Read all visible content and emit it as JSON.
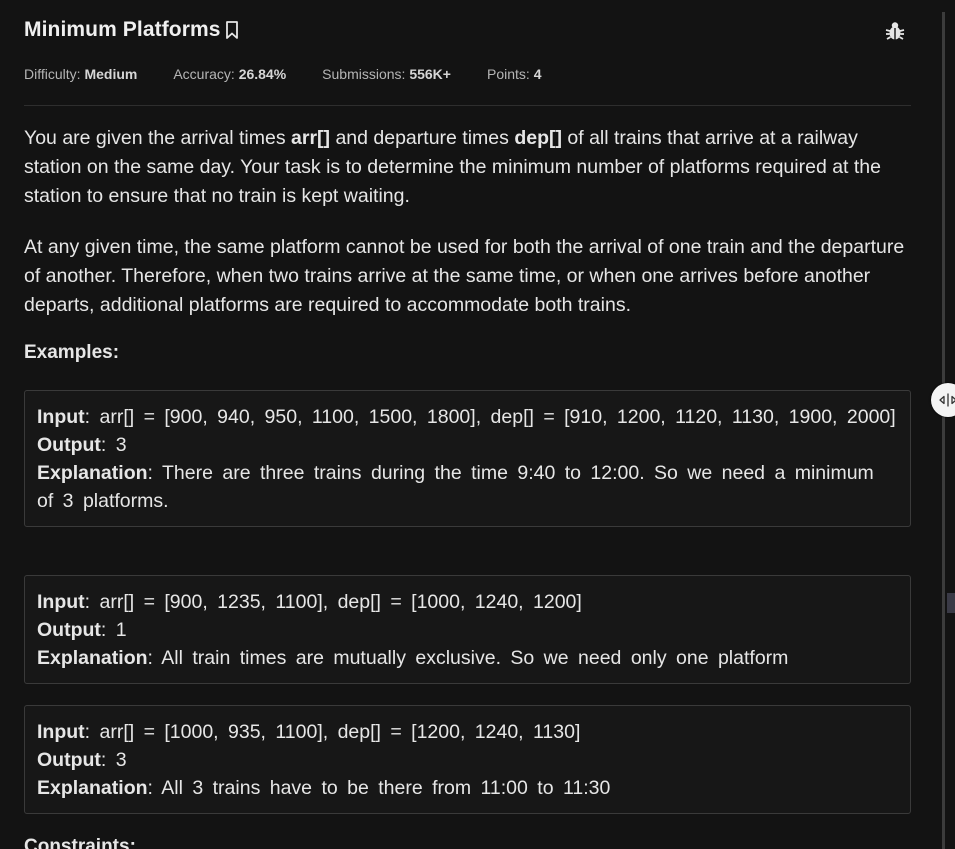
{
  "problem": {
    "title": "Minimum Platforms",
    "meta": {
      "difficulty_label": "Difficulty:",
      "difficulty_value": "Medium",
      "accuracy_label": "Accuracy:",
      "accuracy_value": "26.84%",
      "submissions_label": "Submissions:",
      "submissions_value": "556K+",
      "points_label": "Points:",
      "points_value": "4"
    },
    "description": {
      "p1_a": "You are given the arrival times ",
      "p1_arr": "arr[]",
      "p1_b": " and departure times ",
      "p1_dep": "dep[]",
      "p1_c": " of all trains that arrive at a railway station on the same day. Your task is to determine the minimum number of platforms required at the station to ensure that no train is kept waiting.",
      "p2": "At any given time, the same platform cannot be used for both the arrival of one train and the departure of another. Therefore, when two trains arrive at the same time, or when one arrives before another departs, additional platforms are required to accommodate both trains."
    },
    "examples_heading": "Examples:",
    "examples": [
      {
        "input_label": "Input",
        "input": ": arr[] = [900, 940, 950, 1100, 1500, 1800], dep[] = [910, 1200, 1120, 1130, 1900, 2000]",
        "output_label": "Output",
        "output": ": 3",
        "explanation_label": "Explanation",
        "explanation": ": There are three trains during the time 9:40 to 12:00. So we need a minimum of 3 platforms."
      },
      {
        "input_label": "Input",
        "input": ": arr[] = [900, 1235, 1100], dep[] = [1000, 1240, 1200]",
        "output_label": "Output",
        "output": ": 1",
        "explanation_label": "Explanation",
        "explanation": ": All train times are mutually exclusive. So we need only one platform"
      },
      {
        "input_label": "Input",
        "input": ": arr[] = [1000, 935, 1100], dep[] = [1200, 1240, 1130]",
        "output_label": "Output",
        "output": ": 3",
        "explanation_label": "Explanation",
        "explanation": ": All 3 trains have to be there from 11:00 to 11:30"
      }
    ],
    "next_heading": "Constraints:"
  },
  "icons": {
    "bookmark": "bookmark-icon",
    "bug": "bug-icon",
    "resize": "resize-handle-icon"
  },
  "colors": {
    "background": "#131313",
    "text": "#e6e6e6",
    "muted": "#b5b5b5",
    "border": "#3a3a3a"
  }
}
